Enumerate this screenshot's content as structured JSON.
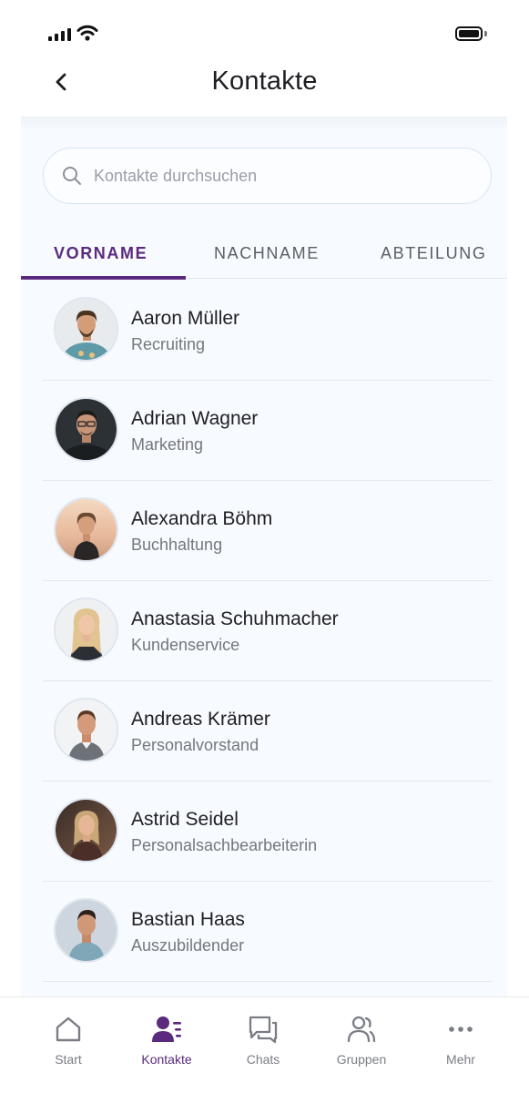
{
  "header": {
    "title": "Kontakte"
  },
  "search": {
    "placeholder": "Kontakte durchsuchen"
  },
  "tabs": [
    {
      "label": "VORNAME",
      "active": true
    },
    {
      "label": "NACHNAME",
      "active": false
    },
    {
      "label": "ABTEILUNG",
      "active": false
    }
  ],
  "contacts": [
    {
      "name": "Aaron Müller",
      "department": "Recruiting"
    },
    {
      "name": "Adrian Wagner",
      "department": "Marketing"
    },
    {
      "name": "Alexandra Böhm",
      "department": "Buchhaltung"
    },
    {
      "name": "Anastasia Schuhmacher",
      "department": "Kundenservice"
    },
    {
      "name": "Andreas Krämer",
      "department": "Personalvorstand"
    },
    {
      "name": "Astrid Seidel",
      "department": "Personalsachbearbeiterin"
    },
    {
      "name": "Bastian Haas",
      "department": "Auszubildender"
    }
  ],
  "nav": [
    {
      "label": "Start",
      "icon": "home-icon"
    },
    {
      "label": "Kontakte",
      "icon": "contacts-icon",
      "active": true
    },
    {
      "label": "Chats",
      "icon": "chat-icon"
    },
    {
      "label": "Gruppen",
      "icon": "group-icon"
    },
    {
      "label": "Mehr",
      "icon": "more-icon"
    }
  ],
  "colors": {
    "accent": "#5b2a7e",
    "background": "#f7fafe",
    "muted": "#75777e"
  }
}
